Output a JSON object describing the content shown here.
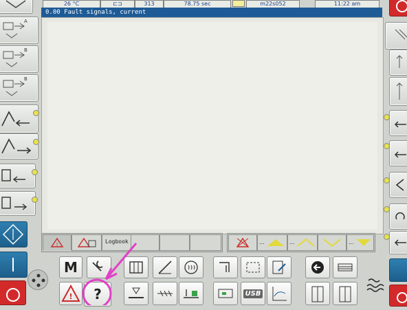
{
  "top_bar": {
    "temperature": "26 °C",
    "counter": "313",
    "cycle_time": "78.75 sec",
    "dataset": "m22s052",
    "clock": "11:22 am"
  },
  "status_line": {
    "message": "0.00 Fault signals, current"
  },
  "tabs": [
    {
      "label": ""
    },
    {
      "label": ""
    },
    {
      "label": "Logbook"
    }
  ],
  "softkey_row": {
    "item_ellipsis_1": "...",
    "item_ellipsis_2": "...",
    "item_ellipsis_3": "..."
  },
  "side_labels": {
    "a": "A",
    "b": "B",
    "m": "M"
  },
  "keypad": {
    "m_key": "M",
    "help_key": "?",
    "usb_key": "USB"
  },
  "colors": {
    "status_bar": "#1e5b96",
    "side_key_blue": "#2063a0",
    "led_yellow": "#e7e24a",
    "annotation_pink": "#e23fc9",
    "warning_red": "#cc2a2a"
  }
}
